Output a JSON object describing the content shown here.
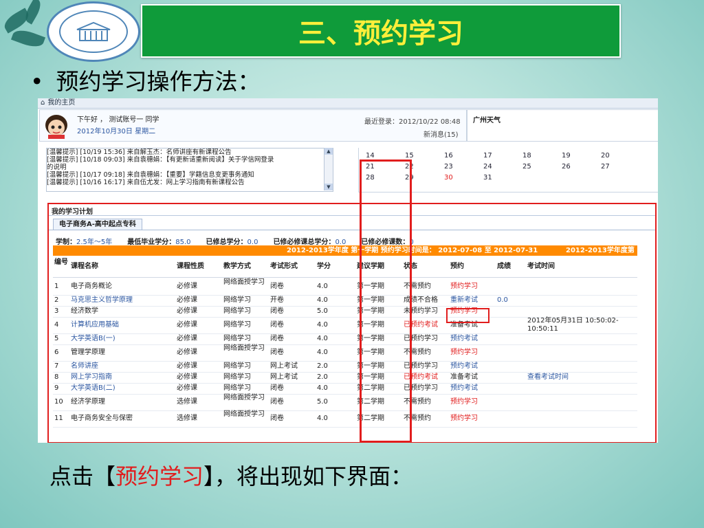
{
  "slide": {
    "title": "三、预约学习",
    "heading": "预约学习操作方法：",
    "bullet": "•",
    "footer_prefix": "点击【",
    "footer_highlight": "预约学习",
    "footer_suffix": "】，将出现如下界面："
  },
  "portal": {
    "home_tab": "我的主页",
    "greeting": "下午好 ， 测试账号一  同学",
    "date": "2012年10月30日  星期二",
    "last_login": "最近登录：2012/10/22 08:48",
    "new_messages": "新消息(15)",
    "weather": "广州天气",
    "notices": [
      "[温馨提示] [10/19 15:36] 来自解玉杰：名师讲座有新课程公告",
      "[温馨提示] [10/18 09:03] 来自袁穗娟：【有更新请重新阅读】关于学信网登录",
      "的说明",
      "[温馨提示] [10/17 09:18] 来自袁穗娟：【重要】学籍信息变更事务通知",
      "[温馨提示] [10/16 16:17] 来自伍尤发：网上学习指南有新课程公告"
    ],
    "calendar_rows": [
      [
        "14",
        "15",
        "16",
        "17",
        "18",
        "19",
        "20"
      ],
      [
        "21",
        "22",
        "23",
        "24",
        "25",
        "26",
        "27"
      ],
      [
        "28",
        "29",
        "30",
        "31",
        "",
        "",
        ""
      ]
    ],
    "calendar_highlight_color": "#e11d1d"
  },
  "plan": {
    "title": "我的学习计划",
    "tab": "电子商务A-高中起点专科",
    "stats": [
      {
        "label": "学制：",
        "value": "2.5年～5年"
      },
      {
        "label": "最低毕业学分：",
        "value": "85.0"
      },
      {
        "label": "已修总学分：",
        "value": "0.0"
      },
      {
        "label": "已修必修课总学分：",
        "value": "0.0"
      },
      {
        "label": "已修必修课数：",
        "value": "0"
      }
    ],
    "term_banner": "2012-2013学年度  第一学期  预约学习时间是：  2012-07-08 至  2012-07-31",
    "term_banner_right": "2012-2013学年度第",
    "headers": [
      "编号",
      "课程名称",
      "课程性质",
      "教学方式",
      "考试形式",
      "学分",
      "建议学期",
      "状态",
      "预约",
      "成绩",
      "考试时间"
    ],
    "rows": [
      {
        "no": "1",
        "name": "电子商务概论",
        "nature": "必修课",
        "mode": "网络面授学习",
        "exam": "闭卷",
        "credit": "4.0",
        "term": "第一学期",
        "status": "不需预约",
        "book": "预约学习",
        "score": "",
        "time": ""
      },
      {
        "no": "2",
        "name": "马克思主义哲学原理",
        "nature": "必修课",
        "mode": "网络学习",
        "exam": "开卷",
        "credit": "4.0",
        "term": "第一学期",
        "status": "成绩不合格",
        "book": "重新考试",
        "score": "0.0",
        "time": ""
      },
      {
        "no": "3",
        "name": "经济数学",
        "nature": "必修课",
        "mode": "网络学习",
        "exam": "闭卷",
        "credit": "5.0",
        "term": "第一学期",
        "status": "未预约学习",
        "book": "预约学习",
        "score": "",
        "time": ""
      },
      {
        "no": "4",
        "name": "计算机应用基础",
        "nature": "必修课",
        "mode": "网络学习",
        "exam": "闭卷",
        "credit": "4.0",
        "term": "第一学期",
        "status": "已预约考试",
        "book": "准备考试",
        "score": "",
        "time": "2012年05月31日 10:50:02-10:50:11"
      },
      {
        "no": "5",
        "name": "大学英语B(一)",
        "nature": "必修课",
        "mode": "网络学习",
        "exam": "闭卷",
        "credit": "4.0",
        "term": "第一学期",
        "status": "已预约学习",
        "book": "预约考试",
        "score": "",
        "time": ""
      },
      {
        "no": "6",
        "name": "管理学原理",
        "nature": "必修课",
        "mode": "网络面授学习",
        "exam": "闭卷",
        "credit": "4.0",
        "term": "第一学期",
        "status": "不需预约",
        "book": "预约学习",
        "score": "",
        "time": ""
      },
      {
        "no": "7",
        "name": "名师讲座",
        "nature": "必修课",
        "mode": "网络学习",
        "exam": "网上考试",
        "credit": "2.0",
        "term": "第一学期",
        "status": "已预约学习",
        "book": "预约考试",
        "score": "",
        "time": ""
      },
      {
        "no": "8",
        "name": "网上学习指南",
        "nature": "必修课",
        "mode": "网络学习",
        "exam": "网上考试",
        "credit": "2.0",
        "term": "第一学期",
        "status": "已预约考试",
        "book": "准备考试",
        "score": "",
        "time": "查看考试时间"
      },
      {
        "no": "9",
        "name": "大学英语B(二)",
        "nature": "必修课",
        "mode": "网络学习",
        "exam": "闭卷",
        "credit": "4.0",
        "term": "第二学期",
        "status": "已预约学习",
        "book": "预约考试",
        "score": "",
        "time": ""
      },
      {
        "no": "10",
        "name": "经济学原理",
        "nature": "选修课",
        "mode": "网络面授学习",
        "exam": "闭卷",
        "credit": "5.0",
        "term": "第二学期",
        "status": "不需预约",
        "book": "预约学习",
        "score": "",
        "time": ""
      },
      {
        "no": "11",
        "name": "电子商务安全与保密",
        "nature": "选修课",
        "mode": "网络面授学习",
        "exam": "闭卷",
        "credit": "4.0",
        "term": "第二学期",
        "status": "不需预约",
        "book": "预约学习",
        "score": "",
        "time": ""
      }
    ]
  }
}
